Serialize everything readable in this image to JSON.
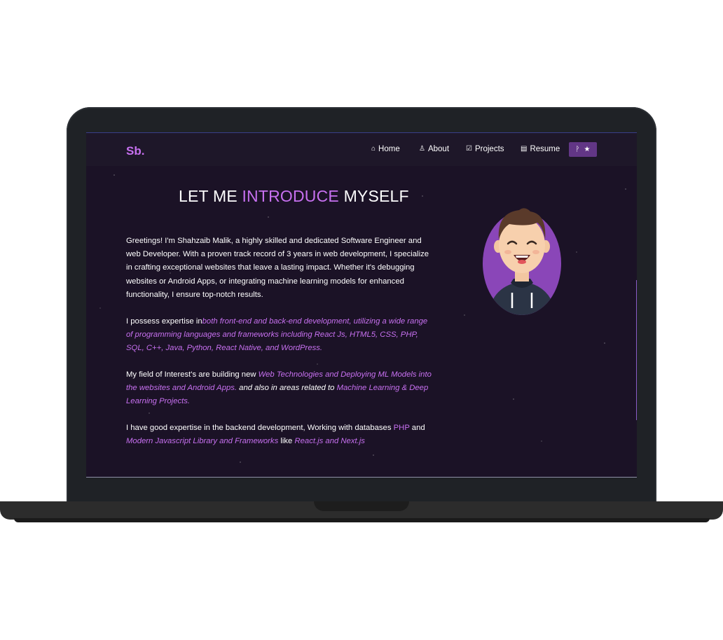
{
  "navbar": {
    "logo": "Sb.",
    "items": [
      {
        "icon": "home-icon",
        "glyph": "⌂",
        "label": "Home"
      },
      {
        "icon": "user-icon",
        "glyph": "♙",
        "label": "About"
      },
      {
        "icon": "projects-icon",
        "glyph": "☑",
        "label": "Projects"
      },
      {
        "icon": "document-icon",
        "glyph": "▤",
        "label": "Resume"
      }
    ],
    "github_button": {
      "icon_left": "fork-icon",
      "glyph_left": "ᚹ",
      "icon_right": "star-icon",
      "glyph_right": "★"
    }
  },
  "main": {
    "heading_prefix": "LET ME ",
    "heading_accent": "INTRODUCE",
    "heading_suffix": " MYSELF",
    "para1": "Greetings! I'm Shahzaib Malik, a highly skilled and dedicated Software Engineer and web Developer. With a proven track record of 3 years in web development, I specialize in crafting exceptional websites that leave a lasting impact. Whether it's debugging websites or Android Apps, or integrating machine learning models for enhanced functionality, I ensure top-notch results.",
    "para2_prefix": "I possess expertise in",
    "para2_accent": "both front-end and back-end development, utilizing a wide range of programming languages and frameworks including React Js, HTML5, CSS, PHP, SQL, C++, Java, Python, React Native, and WordPress.",
    "para3_prefix": "My field of Interest's are building new ",
    "para3_accent1": " Web Technologies and Deploying ML Models into the websites and Android Apps.",
    "para3_mid": " and also in areas related to ",
    "para3_accent2": "Machine Learning & Deep Learning Projects.",
    "para4_prefix": "I have good expertise in the backend development, Working with databases ",
    "para4_php": "PHP",
    "para4_and": " and ",
    "para4_accent1": "Modern Javascript Library and Frameworks",
    "para4_like": "  like ",
    "para4_accent2": "React.js and Next.js"
  },
  "colors": {
    "accent": "#c770f0",
    "background": "#1b1226",
    "avatar_circle": "#8a46b8"
  }
}
